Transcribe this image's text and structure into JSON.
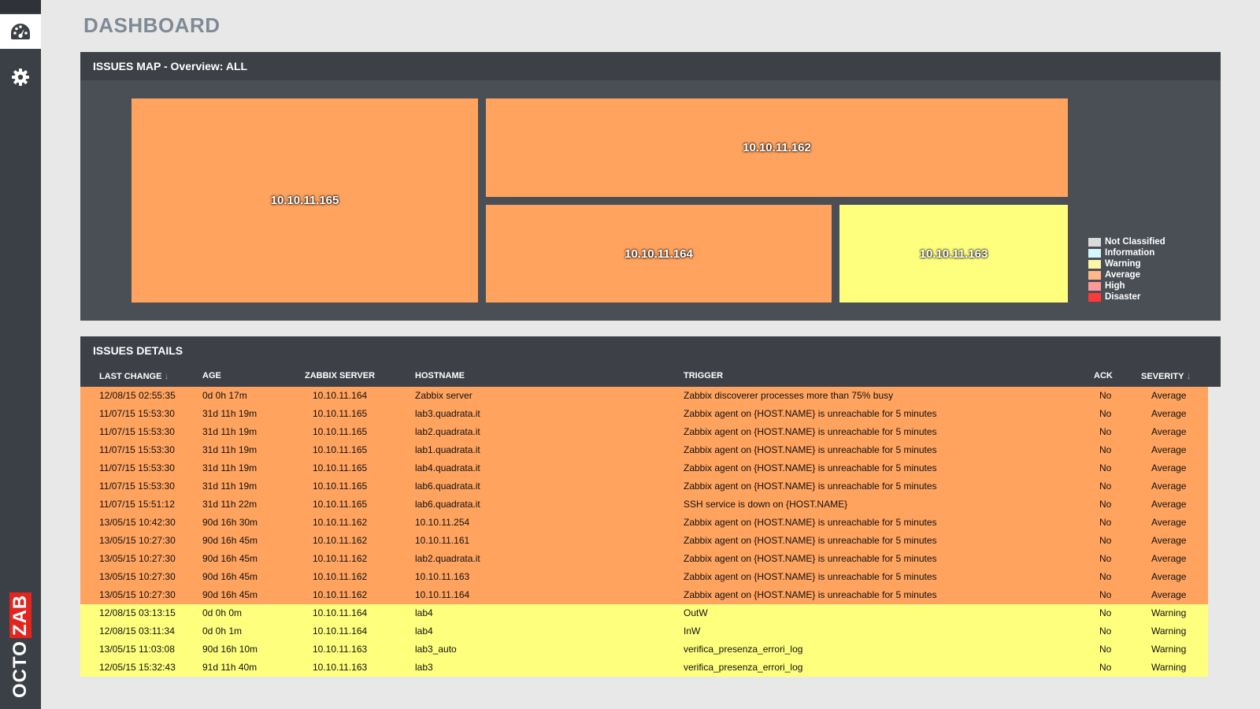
{
  "app": {
    "title": "DASHBOARD",
    "logo_octo": "OCTO",
    "logo_zab": "ZAB"
  },
  "sidebar": {
    "items": [
      {
        "icon": "dashboard-gauge-icon",
        "active": true
      },
      {
        "icon": "gear-icon",
        "active": false
      }
    ]
  },
  "issues_map": {
    "title": "ISSUES MAP - Overview: ALL",
    "tiles": [
      {
        "label": "10.10.11.165",
        "severity": "Average"
      },
      {
        "label": "10.10.11.162",
        "severity": "Average"
      },
      {
        "label": "10.10.11.164",
        "severity": "Average"
      },
      {
        "label": "10.10.11.163",
        "severity": "Warning"
      }
    ],
    "legend": [
      {
        "label": "Not Classified",
        "color": "#dbdbdb"
      },
      {
        "label": "Information",
        "color": "#d6f6ff"
      },
      {
        "label": "Warning",
        "color": "#fff6a5"
      },
      {
        "label": "Average",
        "color": "#ffb689"
      },
      {
        "label": "High",
        "color": "#ff9999"
      },
      {
        "label": "Disaster",
        "color": "#ff3838"
      }
    ]
  },
  "issues_details": {
    "title": "ISSUES DETAILS",
    "columns": {
      "last_change": "LAST CHANGE",
      "age": "AGE",
      "zabbix_server": "ZABBIX SERVER",
      "hostname": "HOSTNAME",
      "trigger": "TRIGGER",
      "ack": "ACK",
      "severity": "SEVERITY"
    },
    "sort_glyph": "↓",
    "rows": [
      {
        "last_change": "12/08/15 02:55:35",
        "age": "0d 0h 17m",
        "server": "10.10.11.164",
        "hostname": "Zabbix server",
        "trigger": "Zabbix discoverer processes more than 75% busy",
        "ack": "No",
        "severity": "Average"
      },
      {
        "last_change": "11/07/15 15:53:30",
        "age": "31d 11h 19m",
        "server": "10.10.11.165",
        "hostname": "lab3.quadrata.it",
        "trigger": "Zabbix agent on {HOST.NAME} is unreachable for 5 minutes",
        "ack": "No",
        "severity": "Average"
      },
      {
        "last_change": "11/07/15 15:53:30",
        "age": "31d 11h 19m",
        "server": "10.10.11.165",
        "hostname": "lab2.quadrata.it",
        "trigger": "Zabbix agent on {HOST.NAME} is unreachable for 5 minutes",
        "ack": "No",
        "severity": "Average"
      },
      {
        "last_change": "11/07/15 15:53:30",
        "age": "31d 11h 19m",
        "server": "10.10.11.165",
        "hostname": "lab1.quadrata.it",
        "trigger": "Zabbix agent on {HOST.NAME} is unreachable for 5 minutes",
        "ack": "No",
        "severity": "Average"
      },
      {
        "last_change": "11/07/15 15:53:30",
        "age": "31d 11h 19m",
        "server": "10.10.11.165",
        "hostname": "lab4.quadrata.it",
        "trigger": "Zabbix agent on {HOST.NAME} is unreachable for 5 minutes",
        "ack": "No",
        "severity": "Average"
      },
      {
        "last_change": "11/07/15 15:53:30",
        "age": "31d 11h 19m",
        "server": "10.10.11.165",
        "hostname": "lab6.quadrata.it",
        "trigger": "Zabbix agent on {HOST.NAME} is unreachable for 5 minutes",
        "ack": "No",
        "severity": "Average"
      },
      {
        "last_change": "11/07/15 15:51:12",
        "age": "31d 11h 22m",
        "server": "10.10.11.165",
        "hostname": "lab6.quadrata.it",
        "trigger": "SSH service is down on {HOST.NAME}",
        "ack": "No",
        "severity": "Average"
      },
      {
        "last_change": "13/05/15 10:42:30",
        "age": "90d 16h 30m",
        "server": "10.10.11.162",
        "hostname": "10.10.11.254",
        "trigger": "Zabbix agent on {HOST.NAME} is unreachable for 5 minutes",
        "ack": "No",
        "severity": "Average"
      },
      {
        "last_change": "13/05/15 10:27:30",
        "age": "90d 16h 45m",
        "server": "10.10.11.162",
        "hostname": "10.10.11.161",
        "trigger": "Zabbix agent on {HOST.NAME} is unreachable for 5 minutes",
        "ack": "No",
        "severity": "Average"
      },
      {
        "last_change": "13/05/15 10:27:30",
        "age": "90d 16h 45m",
        "server": "10.10.11.162",
        "hostname": "lab2.quadrata.it",
        "trigger": "Zabbix agent on {HOST.NAME} is unreachable for 5 minutes",
        "ack": "No",
        "severity": "Average"
      },
      {
        "last_change": "13/05/15 10:27:30",
        "age": "90d 16h 45m",
        "server": "10.10.11.162",
        "hostname": "10.10.11.163",
        "trigger": "Zabbix agent on {HOST.NAME} is unreachable for 5 minutes",
        "ack": "No",
        "severity": "Average"
      },
      {
        "last_change": "13/05/15 10:27:30",
        "age": "90d 16h 45m",
        "server": "10.10.11.162",
        "hostname": "10.10.11.164",
        "trigger": "Zabbix agent on {HOST.NAME} is unreachable for 5 minutes",
        "ack": "No",
        "severity": "Average"
      },
      {
        "last_change": "12/08/15 03:13:15",
        "age": "0d 0h 0m",
        "server": "10.10.11.164",
        "hostname": "lab4",
        "trigger": "OutW",
        "ack": "No",
        "severity": "Warning"
      },
      {
        "last_change": "12/08/15 03:11:34",
        "age": "0d 0h 1m",
        "server": "10.10.11.164",
        "hostname": "lab4",
        "trigger": "InW",
        "ack": "No",
        "severity": "Warning"
      },
      {
        "last_change": "13/05/15 11:03:08",
        "age": "90d 16h 10m",
        "server": "10.10.11.163",
        "hostname": "lab3_auto",
        "trigger": "verifica_presenza_errori_log",
        "ack": "No",
        "severity": "Warning"
      },
      {
        "last_change": "12/05/15 15:32:43",
        "age": "91d 11h 40m",
        "server": "10.10.11.163",
        "hostname": "lab3",
        "trigger": "verifica_presenza_errori_log",
        "ack": "No",
        "severity": "Warning"
      }
    ]
  }
}
